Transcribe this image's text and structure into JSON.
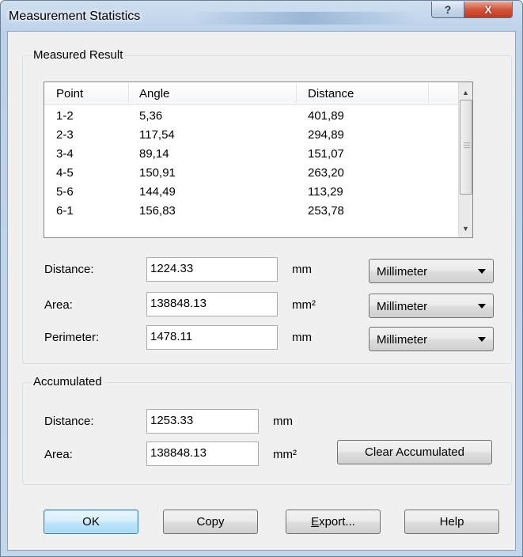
{
  "window": {
    "title": "Measurement Statistics",
    "help_label": "?",
    "close_label": "X"
  },
  "measured_result": {
    "group_label": "Measured Result",
    "columns": [
      "Point",
      "Angle",
      "Distance"
    ],
    "rows": [
      {
        "point": "1-2",
        "angle": "5,36",
        "distance": "401,89"
      },
      {
        "point": "2-3",
        "angle": "117,54",
        "distance": "294,89"
      },
      {
        "point": "3-4",
        "angle": "89,14",
        "distance": "151,07"
      },
      {
        "point": "4-5",
        "angle": "150,91",
        "distance": "263,20"
      },
      {
        "point": "5-6",
        "angle": "144,49",
        "distance": "113,29"
      },
      {
        "point": "6-1",
        "angle": "156,83",
        "distance": "253,78"
      }
    ],
    "distance": {
      "label": "Distance:",
      "value": "1224.33",
      "unit": "mm",
      "unit_select": "Millimeter"
    },
    "area": {
      "label": "Area:",
      "value": "138848.13",
      "unit": "mm²",
      "unit_select": "Millimeter"
    },
    "perimeter": {
      "label": "Perimeter:",
      "value": "1478.11",
      "unit": "mm",
      "unit_select": "Millimeter"
    }
  },
  "accumulated": {
    "group_label": "Accumulated",
    "distance": {
      "label": "Distance:",
      "value": "1253.33",
      "unit": "mm"
    },
    "area": {
      "label": "Area:",
      "value": "138848.13",
      "unit": "mm²"
    },
    "clear_label": "Clear Accumulated"
  },
  "buttons": {
    "ok": "OK",
    "copy": "Copy",
    "export_first": "E",
    "export_rest": "xport...",
    "help": "Help"
  },
  "icons": {
    "scroll_up": "scroll-up-icon",
    "scroll_down": "scroll-down-icon",
    "dropdown": "chevron-down-icon"
  }
}
